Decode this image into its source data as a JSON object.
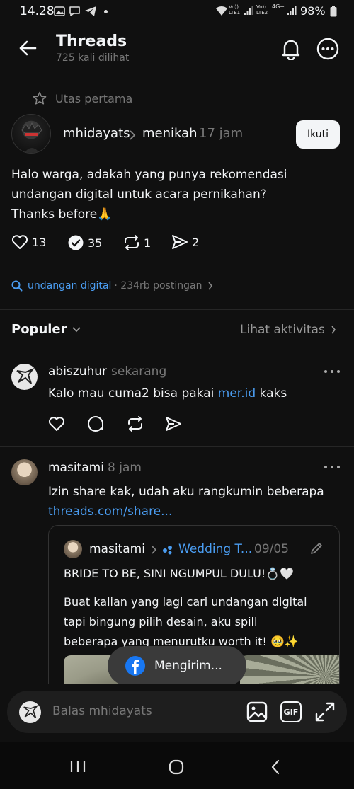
{
  "status_bar": {
    "time": "14.28",
    "sim1": "Vo))\nLTE1",
    "sim2": "Vo))\nLTE2",
    "net": "4G+",
    "battery": "98%"
  },
  "header": {
    "title": "Threads",
    "subtitle": "725 kali dilihat"
  },
  "pinned_label": "Utas pertama",
  "post": {
    "author": "mhidayats",
    "topic": "menikah",
    "time": "17 jam",
    "follow_label": "Ikuti",
    "text_line1": "Halo warga, adakah yang punya rekomendasi",
    "text_line2": "undangan digital untuk acara pernikahan?",
    "text_line3": "Thanks before🙏",
    "likes": "13",
    "replies": "35",
    "reposts": "1",
    "shares": "2"
  },
  "tag": {
    "name": "undangan digital",
    "meta": "· 234rb postingan"
  },
  "sort": {
    "label": "Populer",
    "activity_label": "Lihat aktivitas"
  },
  "replies": [
    {
      "author": "abiszuhur",
      "time": "sekarang",
      "text": "Kalo mau cuma2 bisa pakai ",
      "link": "mer.id",
      "text_after": " kaks"
    },
    {
      "author": "masitami",
      "time": "8 jam",
      "text": "Izin share kak, udah aku rangkumin beberapa",
      "link": "threads.com/share..."
    }
  ],
  "quoted": {
    "author": "masitami",
    "topic": "Wedding T...",
    "date": "09/05",
    "line1": "BRIDE TO BE, SINI NGUMPUL DULU!💍🤍",
    "line2": "Buat kalian yang lagi cari undangan digital",
    "line3": "tapi bingung pilih desain, aku spill",
    "line4": "beberapa yang menurutku worth it! 🥹✨"
  },
  "toast": {
    "label": "Mengirim..."
  },
  "reply_bar": {
    "placeholder": "Balas mhidayats",
    "gif_label": "GIF"
  },
  "colors": {
    "background": "#101010",
    "link": "#4a9cf0",
    "follow_bg": "#f3f5f7"
  }
}
